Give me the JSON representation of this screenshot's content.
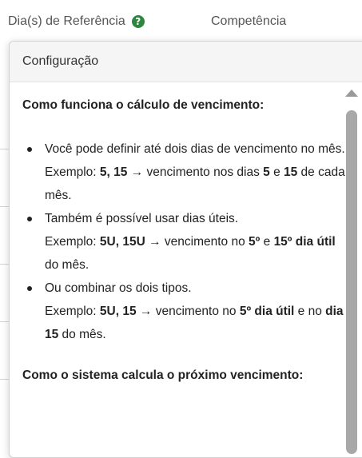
{
  "form": {
    "field1_label": "Dia(s) de Referência",
    "field1_help": "?",
    "field2_label": "Competência"
  },
  "popover": {
    "title": "Configuração",
    "section1_title": "Como funciona o cálculo de vencimento:",
    "bullets": [
      {
        "line1": "Você pode definir até dois dias de vencimento no mês.",
        "ex_prefix": "Exemplo: ",
        "ex_value": "5, 15",
        "ex_mid": " → vencimento nos dias ",
        "ex_a": "5",
        "ex_and": " e ",
        "ex_b": "15",
        "ex_end": " de cada mês."
      },
      {
        "line1": "Também é possível usar dias úteis.",
        "ex_prefix": "Exemplo: ",
        "ex_value": "5U, 15U",
        "ex_mid": " → vencimento no ",
        "ex_a": "5º",
        "ex_and": " e ",
        "ex_b": "15º dia útil",
        "ex_end": " do mês."
      },
      {
        "line1": "Ou combinar os dois tipos.",
        "ex_prefix": "Exemplo: ",
        "ex_value": "5U, 15",
        "ex_mid": " → vencimento no ",
        "ex_a": "5º dia útil",
        "ex_and": " e no ",
        "ex_b": "dia 15",
        "ex_end": " do mês."
      }
    ],
    "section2_title": "Como o sistema calcula o próximo vencimento:"
  },
  "colors": {
    "help_badge": "#2e8540",
    "header_bg": "#f5f5f5",
    "scroll_thumb": "#a8a8a8"
  }
}
